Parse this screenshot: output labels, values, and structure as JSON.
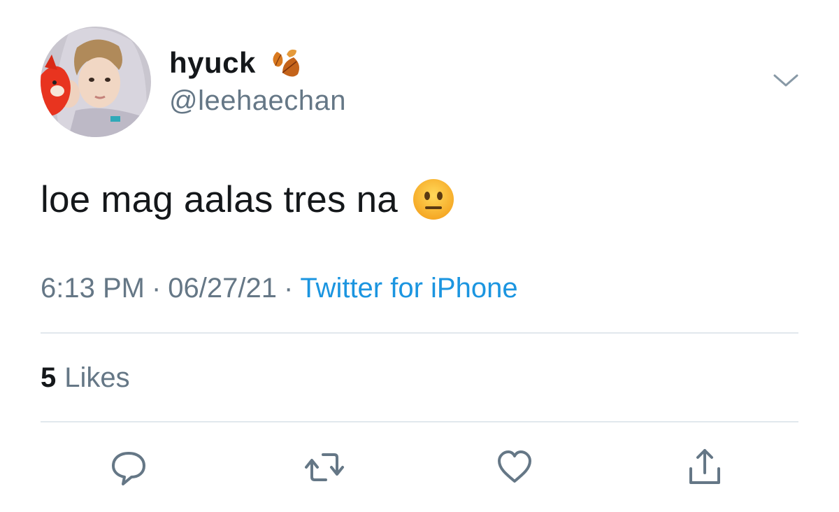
{
  "user": {
    "display_name": "hyuck",
    "name_emoji": "fallen-leaf-icon",
    "handle": "@leehaechan"
  },
  "tweet": {
    "text": "loe mag aalas tres na",
    "emoji": "neutral-face-icon"
  },
  "meta": {
    "time": "6:13 PM",
    "separator": "·",
    "date": "06/27/21",
    "source": "Twitter for iPhone"
  },
  "stats": {
    "likes_count": "5",
    "likes_label": "Likes"
  },
  "actions": [
    "reply-icon",
    "retweet-icon",
    "like-icon",
    "share-icon"
  ],
  "colors": {
    "text": "#14171a",
    "secondary": "#657786",
    "link": "#1b95e0",
    "divider": "#e1e8ed"
  }
}
